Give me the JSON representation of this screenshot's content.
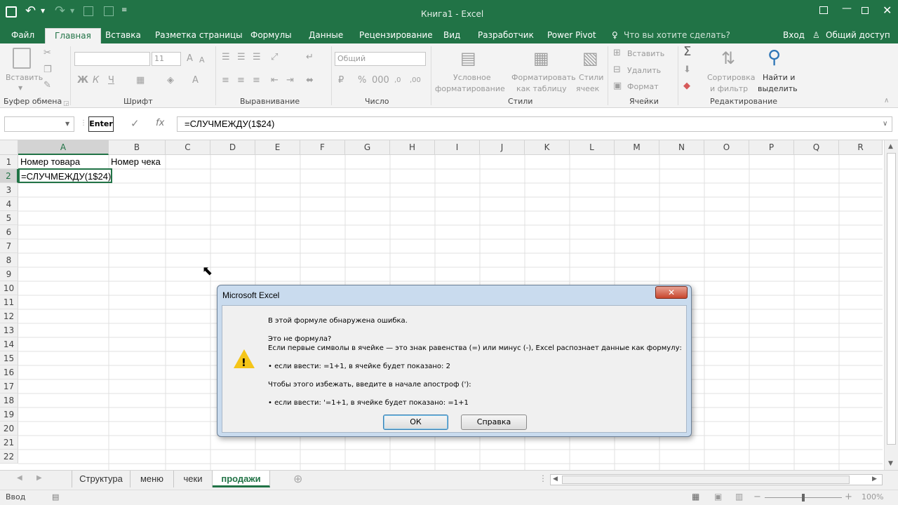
{
  "titlebar": {
    "title": "Книга1 - Excel"
  },
  "ribbon_tabs": [
    "Файл",
    "Главная",
    "Вставка",
    "Разметка страницы",
    "Формулы",
    "Данные",
    "Рецензирование",
    "Вид",
    "Разработчик",
    "Power Pivot"
  ],
  "tellme": "Что вы хотите сделать?",
  "signin": "Вход",
  "share": "Общий доступ",
  "ribbon": {
    "clipboard": {
      "paste": "Вставить",
      "label": "Буфер обмена"
    },
    "font": {
      "size": "11",
      "bold": "Ж",
      "italic": "К",
      "underline": "Ч",
      "label": "Шрифт"
    },
    "alignment": {
      "label": "Выравнивание"
    },
    "number": {
      "format": "Общий",
      "label": "Число"
    },
    "styles": {
      "cond1": "Условное",
      "cond2": "форматирование",
      "table1": "Форматировать",
      "table2": "как таблицу",
      "cell1": "Стили",
      "cell2": "ячеек",
      "label": "Стили"
    },
    "cells": {
      "insert": "Вставить",
      "delete": "Удалить",
      "format": "Формат",
      "label": "Ячейки"
    },
    "editing": {
      "sort1": "Сортировка",
      "sort2": "и фильтр",
      "find1": "Найти и",
      "find2": "выделить",
      "label": "Редактирование"
    }
  },
  "formula_bar": {
    "mode": "Enter",
    "fx": "fx",
    "formula": "=СЛУЧМЕЖДУ(1$24)"
  },
  "columns": [
    "A",
    "B",
    "C",
    "D",
    "E",
    "F",
    "G",
    "H",
    "I",
    "J",
    "K",
    "L",
    "M",
    "N",
    "O",
    "P",
    "Q",
    "R"
  ],
  "rows": [
    "1",
    "2",
    "3",
    "4",
    "5",
    "6",
    "7",
    "8",
    "9",
    "10",
    "11",
    "12",
    "13",
    "14",
    "15",
    "16",
    "17",
    "18",
    "19",
    "20",
    "21",
    "22"
  ],
  "cells": {
    "A1": "Номер товара",
    "B1": "Номер чека",
    "A2": "=СЛУЧМЕЖДУ(1$24)"
  },
  "sheet_tabs": [
    "Структура",
    "меню",
    "чеки",
    "продажи"
  ],
  "status": {
    "mode": "Ввод",
    "zoom": "100%"
  },
  "dialog": {
    "title": "Microsoft Excel",
    "line1": "В этой формуле обнаружена ошибка.",
    "line2": "Это не формула?",
    "line3": "Если первые символы в ячейке — это знак равенства (=) или минус (-), Excel распознает данные как формулу:",
    "line4": "• если ввести: =1+1, в ячейке будет показано: 2",
    "line5": "Чтобы этого избежать, введите в начале апостроф ('):",
    "line6": "• если ввести: '=1+1, в ячейке будет показано: =1+1",
    "ok": "ОК",
    "help": "Справка"
  },
  "colors": {
    "excel_green": "#217346",
    "ribbon_bg": "#f3f3f3",
    "dialog_frame": "#c9dbee"
  }
}
